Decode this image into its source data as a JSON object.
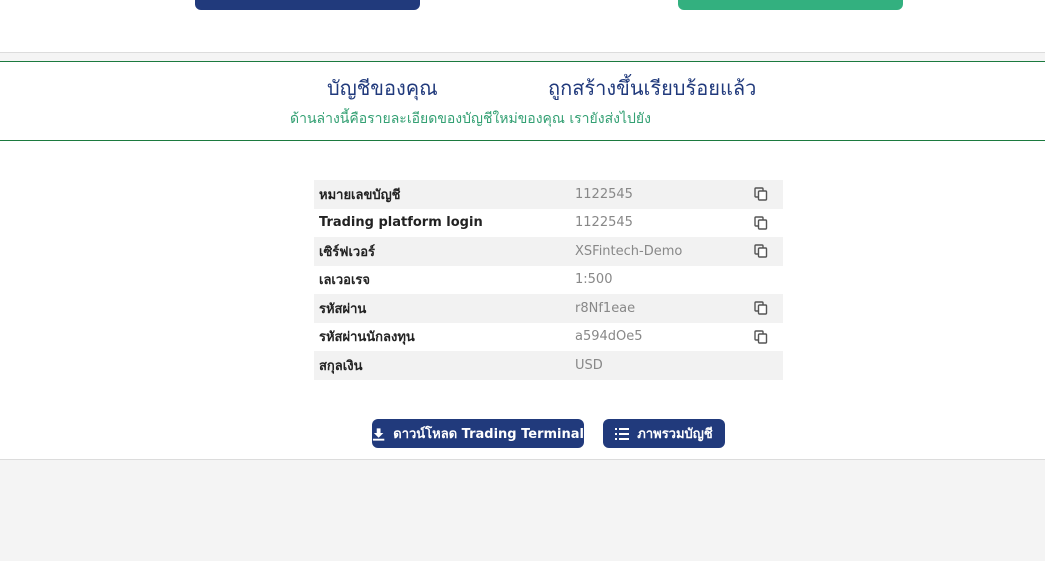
{
  "header": {
    "title_part1": "บัญชีของคุณ",
    "title_part2": "ถูกสร้างขึ้นเรียบร้อยแล้ว",
    "subtitle": "ด้านล่างนี้คือรายละเอียดของบัญชีใหม่ของคุณ เรายังส่งไปยัง"
  },
  "account_details": [
    {
      "label": "หมายเลขบัญชี",
      "value": "1122545",
      "copyable": true
    },
    {
      "label": "Trading platform login",
      "value": "1122545",
      "copyable": true
    },
    {
      "label": "เซิร์ฟเวอร์",
      "value": "XSFintech-Demo",
      "copyable": true
    },
    {
      "label": "เลเวอเรจ",
      "value": "1:500",
      "copyable": false
    },
    {
      "label": "รหัสผ่าน",
      "value": "r8Nf1eae",
      "copyable": true
    },
    {
      "label": "รหัสผ่านนักลงทุน",
      "value": "a594dOe5",
      "copyable": true
    },
    {
      "label": "สกุลเงิน",
      "value": "USD",
      "copyable": false
    }
  ],
  "actions": {
    "download_label": "ดาวน์โหลด Trading Terminal",
    "overview_label": "ภาพรวมบัญชี"
  },
  "icons": {
    "copy": "copy-icon",
    "download": "download-icon",
    "list": "list-icon"
  },
  "colors": {
    "primary": "#213a7c",
    "accent_green": "#33b07f",
    "subtitle_green": "#33a073"
  }
}
